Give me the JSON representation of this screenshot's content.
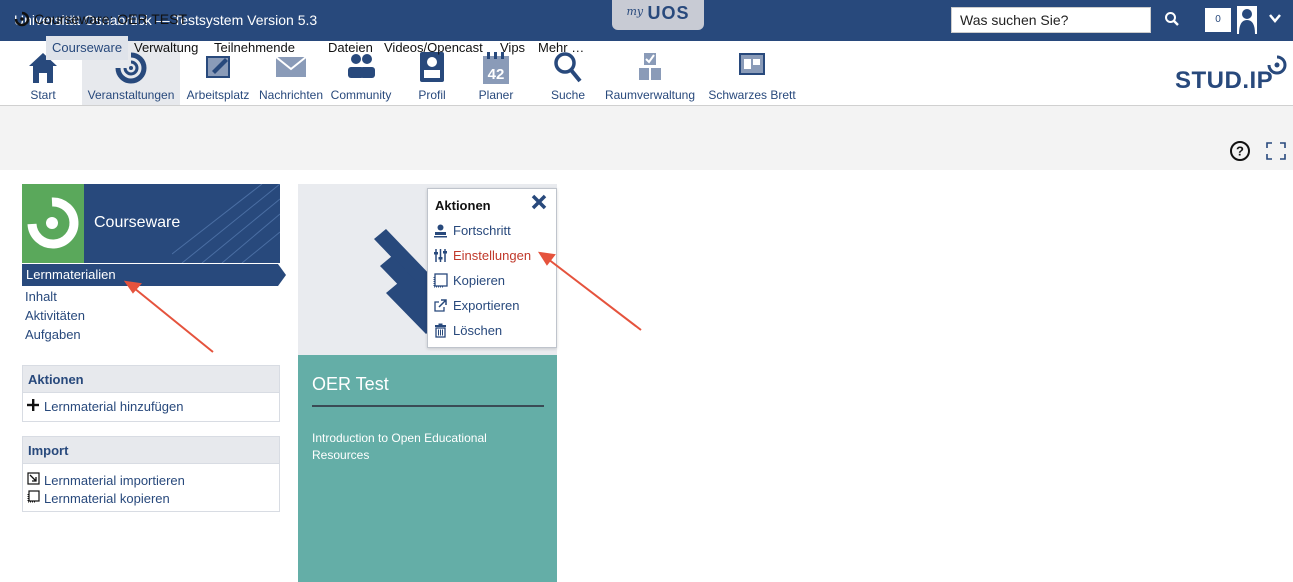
{
  "topbar": {
    "title": "Universität Osnabrück — Testsystem Version 5.3",
    "myuos_my": "my",
    "myuos_uos": "UOS",
    "search_placeholder": "Was suchen Sie?",
    "notification_count": "0"
  },
  "nav": {
    "items": [
      {
        "label": "Start",
        "icon": "home-icon"
      },
      {
        "label": "Veranstaltungen",
        "icon": "courses-icon",
        "active": true
      },
      {
        "label": "Arbeitsplatz",
        "icon": "workspace-icon"
      },
      {
        "label": "Nachrichten",
        "icon": "mail-icon"
      },
      {
        "label": "Community",
        "icon": "community-icon"
      },
      {
        "label": "Profil",
        "icon": "profile-icon"
      },
      {
        "label": "Planer",
        "icon": "calendar-icon",
        "badge": "42"
      },
      {
        "label": "Suche",
        "icon": "search-icon"
      },
      {
        "label": "Raumverwaltung",
        "icon": "rooms-icon"
      },
      {
        "label": "Schwarzes Brett",
        "icon": "board-icon"
      }
    ],
    "logo_text": "STUD.IP"
  },
  "context": {
    "title": "Courseware: OER TEST",
    "tabs": [
      {
        "label": "Courseware",
        "active": true
      },
      {
        "label": "Verwaltung"
      },
      {
        "label": "Teilnehmende"
      },
      {
        "label": "Dateien"
      },
      {
        "label": "Videos/Opencast"
      },
      {
        "label": "Vips"
      },
      {
        "label": "Mehr …"
      }
    ]
  },
  "sidebar": {
    "header_title": "Courseware",
    "nav": [
      "Lernmaterialien",
      "Inhalt",
      "Aktivitäten",
      "Aufgaben"
    ],
    "actions_title": "Aktionen",
    "actions": [
      {
        "label": "Lernmaterial hinzufügen",
        "icon": "plus-icon"
      }
    ],
    "import_title": "Import",
    "import": [
      {
        "label": "Lernmaterial importieren",
        "icon": "import-icon"
      },
      {
        "label": "Lernmaterial kopieren",
        "icon": "copy-icon"
      }
    ]
  },
  "card": {
    "title": "OER Test",
    "description": "Introduction to Open Educational Resources"
  },
  "popup": {
    "title": "Aktionen",
    "items": [
      {
        "label": "Fortschritt",
        "icon": "progress-icon"
      },
      {
        "label": "Einstellungen",
        "icon": "settings-icon",
        "highlight": true
      },
      {
        "label": "Kopieren",
        "icon": "copy-icon"
      },
      {
        "label": "Exportieren",
        "icon": "export-icon"
      },
      {
        "label": "Löschen",
        "icon": "trash-icon"
      }
    ]
  },
  "colors": {
    "brand": "#28497c",
    "card_teal": "#64aea7",
    "highlight_red": "#c0392b",
    "courseware_green": "#5aa85b"
  }
}
